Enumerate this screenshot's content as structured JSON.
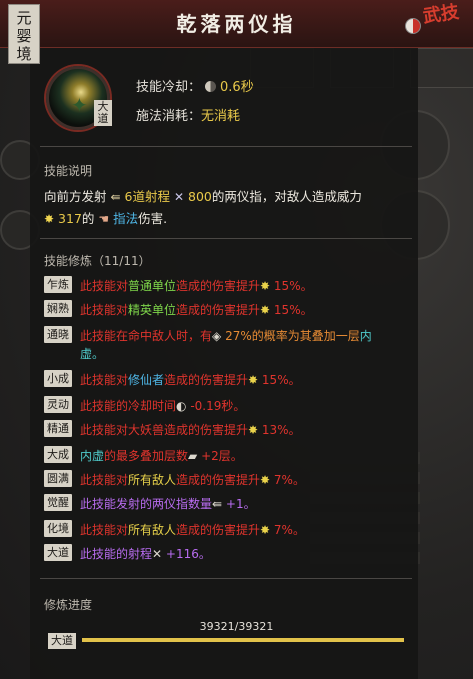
{
  "realm": "元婴境",
  "header": {
    "title": "乾落两仪指",
    "corner_text": "武技"
  },
  "skill": {
    "badge": "大道",
    "cooldown_label": "技能冷却：",
    "cooldown_value": "0.6秒",
    "cost_label": "施法消耗：",
    "cost_value": "无消耗"
  },
  "description": {
    "section_label": "技能说明",
    "p1": "向前方发射",
    "count": "6道射程",
    "range": "800",
    "p2": "的两仪指，对敌人造成威力",
    "power": "317",
    "p3": "的",
    "type": "指法",
    "p4": "伤害."
  },
  "cultivation": {
    "section_label": "技能修炼（11/11）",
    "rows": [
      {
        "tag": "乍炼",
        "segs": [
          [
            "此技能对",
            "red"
          ],
          [
            "普通单位",
            "green"
          ],
          [
            "造成的伤害提升",
            "red"
          ],
          [
            "✸",
            "yellow"
          ],
          [
            " 15%。",
            "red"
          ]
        ]
      },
      {
        "tag": "娴熟",
        "segs": [
          [
            "此技能对",
            "red"
          ],
          [
            "精英单位",
            "green"
          ],
          [
            "造成的伤害提升",
            "red"
          ],
          [
            "✸",
            "yellow"
          ],
          [
            " 15%。",
            "red"
          ]
        ]
      },
      {
        "tag": "通晓",
        "segs": [
          [
            "此技能在命中敌人时，有",
            "red"
          ],
          [
            "◈",
            "white"
          ],
          [
            " 27%的概率为其叠加一层",
            "orange"
          ],
          [
            "内",
            "cyan"
          ]
        ],
        "line2": [
          [
            "虚。",
            "cyan"
          ]
        ]
      },
      {
        "tag": "小成",
        "segs": [
          [
            "此技能对",
            "red"
          ],
          [
            "修仙者",
            "blue"
          ],
          [
            "造成的伤害提升",
            "red"
          ],
          [
            "✸",
            "yellow"
          ],
          [
            " 15%。",
            "red"
          ]
        ]
      },
      {
        "tag": "灵动",
        "segs": [
          [
            "此技能的冷却时间",
            "red"
          ],
          [
            "◐",
            "white"
          ],
          [
            " -0.19秒。",
            "red"
          ]
        ]
      },
      {
        "tag": "精通",
        "segs": [
          [
            "此技能对大妖兽造成的伤害提升",
            "red"
          ],
          [
            "✸",
            "yellow"
          ],
          [
            " 13%。",
            "red"
          ]
        ]
      },
      {
        "tag": "大成",
        "segs": [
          [
            "内虚",
            "cyan"
          ],
          [
            "的最多叠加层数",
            "red"
          ],
          [
            "▰",
            "white"
          ],
          [
            " +2层。",
            "red"
          ]
        ]
      },
      {
        "tag": "圆满",
        "segs": [
          [
            "此技能对",
            "red"
          ],
          [
            "所有敌人",
            "yellow"
          ],
          [
            "造成的伤害提升",
            "red"
          ],
          [
            "✸",
            "yellow"
          ],
          [
            " 7%。",
            "red"
          ]
        ]
      },
      {
        "tag": "觉醒",
        "segs": [
          [
            "此技能发射的两仪指数量",
            "purple"
          ],
          [
            "⇚",
            "white"
          ],
          [
            " +1。",
            "purple"
          ]
        ]
      },
      {
        "tag": "化境",
        "segs": [
          [
            "此技能对",
            "red"
          ],
          [
            "所有敌人",
            "yellow"
          ],
          [
            "造成的伤害提升",
            "red"
          ],
          [
            "✸",
            "yellow"
          ],
          [
            " 7%。",
            "red"
          ]
        ]
      },
      {
        "tag": "大道",
        "segs": [
          [
            "此技能的射程",
            "purple"
          ],
          [
            "✕",
            "white"
          ],
          [
            " +116。",
            "purple"
          ]
        ]
      }
    ]
  },
  "progress": {
    "section_label": "修炼进度",
    "count": "39321/39321",
    "tag": "大道",
    "fraction": 1.0
  },
  "colors": {
    "red": "#e0342d",
    "green": "#7ed54a",
    "yellow": "#e9d24a",
    "purple": "#b86cf0",
    "orange": "#e58a34",
    "cyan": "#4fc9c9",
    "blue": "#4fb6e6",
    "white": "#dcd8ce"
  }
}
